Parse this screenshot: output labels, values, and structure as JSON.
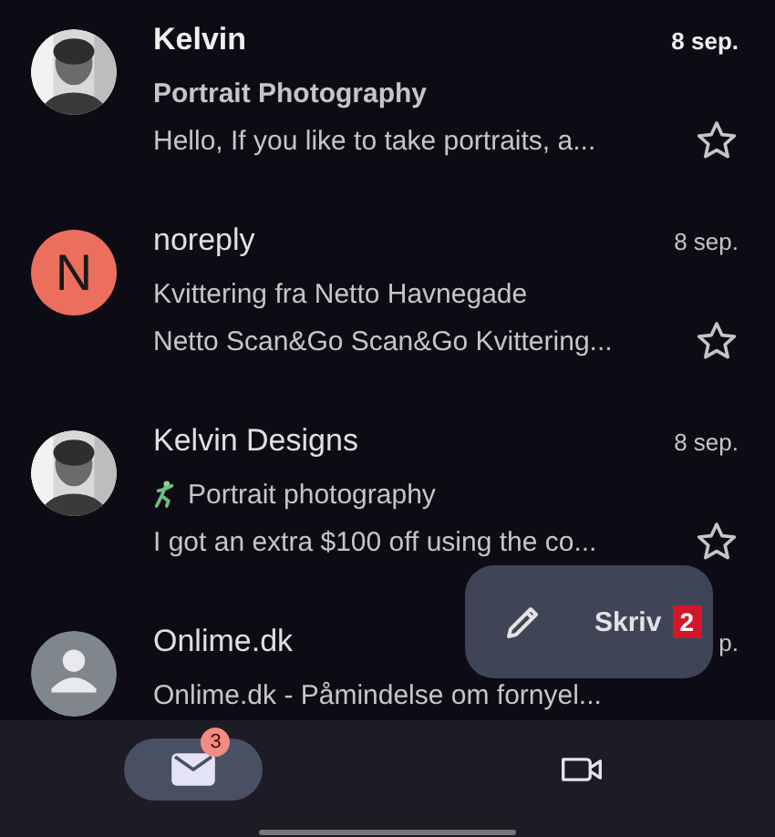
{
  "messages": [
    {
      "sender": "Kelvin",
      "date": "8 sep.",
      "subject": "Portrait Photography",
      "snippet": "Hello, If you like to take portraits, a...",
      "unread": true,
      "starred": false,
      "figure_icon": false
    },
    {
      "sender": "noreply",
      "date": "8 sep.",
      "subject": "Kvittering fra Netto Havnegade",
      "snippet": "Netto Scan&Go Scan&Go Kvittering...",
      "unread": false,
      "starred": false,
      "figure_icon": false,
      "avatar": {
        "kind": "letter",
        "letter": "N",
        "color": "#ec6f5e"
      }
    },
    {
      "sender": "Kelvin Designs",
      "date": "8 sep.",
      "subject": "Portrait photography",
      "snippet": "I got an extra $100 off using the co...",
      "unread": false,
      "starred": false,
      "figure_icon": true
    },
    {
      "sender": "Onlime.dk",
      "date": "p.",
      "subject": "Onlime.dk - Påmindelse om fornyel...",
      "unread": false,
      "figure_icon": false,
      "avatar": {
        "kind": "default"
      }
    }
  ],
  "compose": {
    "label": "Skriv",
    "badge": "2"
  },
  "nav": {
    "items": [
      {
        "kind": "mail",
        "selected": true,
        "badge": "3"
      },
      {
        "kind": "video",
        "selected": false
      }
    ]
  }
}
